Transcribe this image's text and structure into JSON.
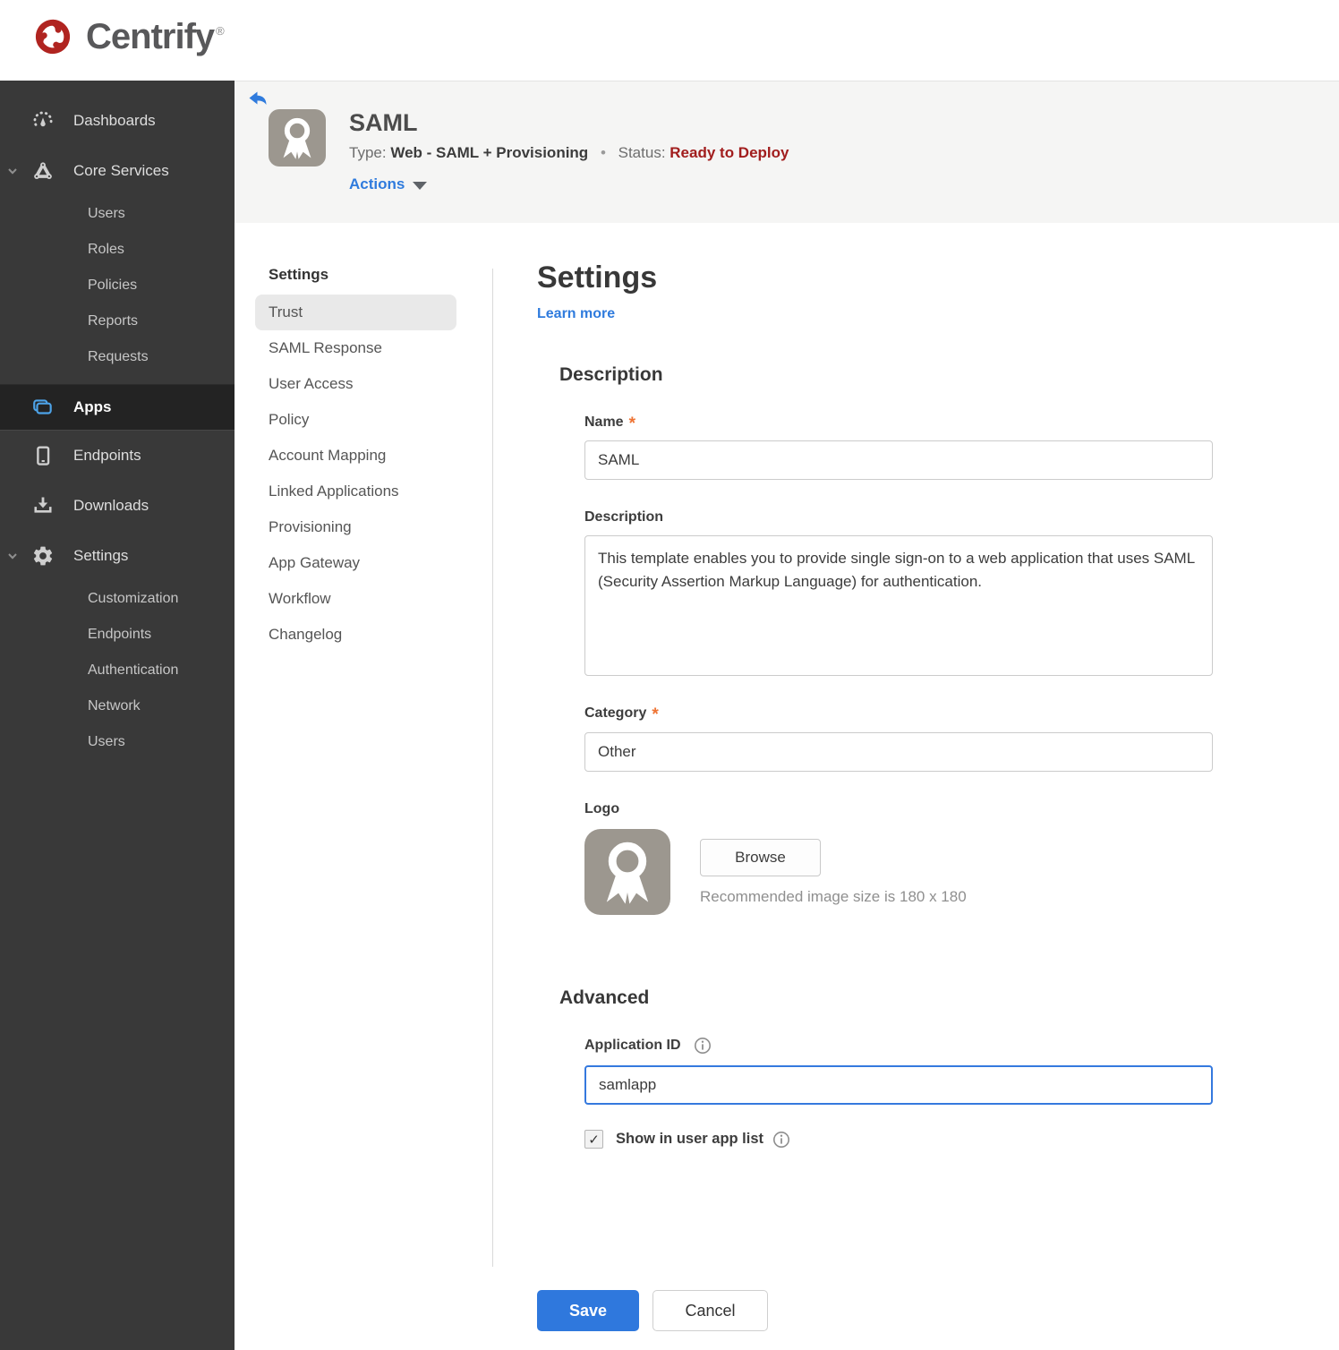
{
  "brand": {
    "name": "Centrify",
    "registered": "®"
  },
  "ui": {
    "required_marker": "*",
    "checkmark": "✓",
    "separator": "•"
  },
  "sidebar": {
    "active_item": "Apps",
    "items": [
      {
        "label": "Dashboards",
        "icon": "gauge-icon"
      },
      {
        "label": "Core Services",
        "icon": "core-services-icon",
        "expanded": true,
        "children": [
          "Users",
          "Roles",
          "Policies",
          "Reports",
          "Requests"
        ]
      },
      {
        "label": "Apps",
        "icon": "apps-icon",
        "active": true
      },
      {
        "label": "Endpoints",
        "icon": "device-icon"
      },
      {
        "label": "Downloads",
        "icon": "download-icon"
      },
      {
        "label": "Settings",
        "icon": "gear-icon",
        "expanded": true,
        "children": [
          "Customization",
          "Endpoints",
          "Authentication",
          "Network",
          "Users"
        ]
      }
    ]
  },
  "app_header": {
    "title": "SAML",
    "type_label": "Type:",
    "type_value": "Web - SAML + Provisioning",
    "status_label": "Status:",
    "status_value": "Ready to Deploy",
    "actions_label": "Actions"
  },
  "settings_nav": {
    "header": "Settings",
    "active_item": "Trust",
    "items": [
      "Trust",
      "SAML Response",
      "User Access",
      "Policy",
      "Account Mapping",
      "Linked Applications",
      "Provisioning",
      "App Gateway",
      "Workflow",
      "Changelog"
    ]
  },
  "form": {
    "title": "Settings",
    "learn_more_label": "Learn more",
    "description": {
      "heading": "Description",
      "name_label": "Name",
      "name_value": "SAML",
      "description_label": "Description",
      "description_value": "This template enables you to provide single sign-on to a web application that uses SAML (Security Assertion Markup Language) for authentication.",
      "category_label": "Category",
      "category_value": "Other",
      "logo_label": "Logo",
      "browse_label": "Browse",
      "logo_hint": "Recommended image size is 180 x 180"
    },
    "advanced": {
      "heading": "Advanced",
      "application_id_label": "Application ID",
      "application_id_value": "samlapp",
      "show_in_user_app_list_label": "Show in user app list",
      "show_in_user_app_list_checked": true
    },
    "actions": {
      "save_label": "Save",
      "cancel_label": "Cancel"
    }
  },
  "colors": {
    "accent_blue": "#2f7bdd",
    "status_red": "#a11d1d",
    "required_orange": "#ee7333",
    "sidebar_bg": "#393939",
    "sidebar_active_bg": "#232323",
    "apps_icon_blue": "#4da3e8",
    "header_band_bg": "#f5f5f4",
    "logo_red": "#b02420",
    "badge_gray": "#9c978f"
  }
}
